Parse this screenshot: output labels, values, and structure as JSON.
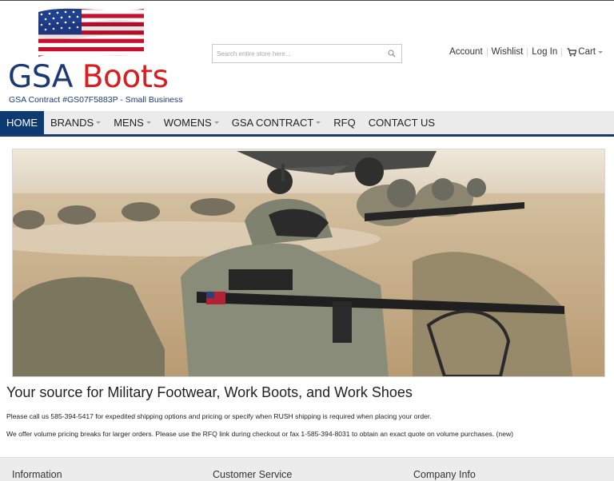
{
  "header": {
    "brand_word1": "GSA",
    "brand_word2": "Boots",
    "tagline": "GSA Contract #GS07F5883P - Small Business",
    "search_placeholder": "Search entire store here...",
    "account_links": [
      "Account",
      "Wishlist",
      "Log In"
    ],
    "cart_label": "Cart"
  },
  "nav": {
    "items": [
      {
        "label": "Home",
        "active": true,
        "has_dropdown": false
      },
      {
        "label": "Brands",
        "active": false,
        "has_dropdown": true
      },
      {
        "label": "Mens",
        "active": false,
        "has_dropdown": true
      },
      {
        "label": "Womens",
        "active": false,
        "has_dropdown": true
      },
      {
        "label": "GSA Contract",
        "active": false,
        "has_dropdown": true
      },
      {
        "label": "RFQ",
        "active": false,
        "has_dropdown": false
      },
      {
        "label": "Contact Us",
        "active": false,
        "has_dropdown": false
      }
    ]
  },
  "main": {
    "headline": "Your source for Military Footwear, Work Boots, and Work Shoes",
    "paragraph1": "Please call us 585-394-5417 for expedited shipping options and pricing or specify when RUSH shipping is required when placing your order.",
    "paragraph2": "We offer volume pricing breaks for larger orders. Please use the RFQ link during checkout or fax 1-585-394-8031 to obtain an exact quote on volume purchases. (new)"
  },
  "footer": {
    "columns": [
      "Information",
      "Customer Service",
      "Company Info"
    ]
  },
  "colors": {
    "brand_navy": "#1b3a73",
    "brand_red": "#d81e1e",
    "nav_active": "#0e3a72",
    "nav_bg": "#ebebeb"
  },
  "icons": {
    "search": "search-icon",
    "cart": "cart-icon",
    "flag": "us-flag-icon"
  }
}
